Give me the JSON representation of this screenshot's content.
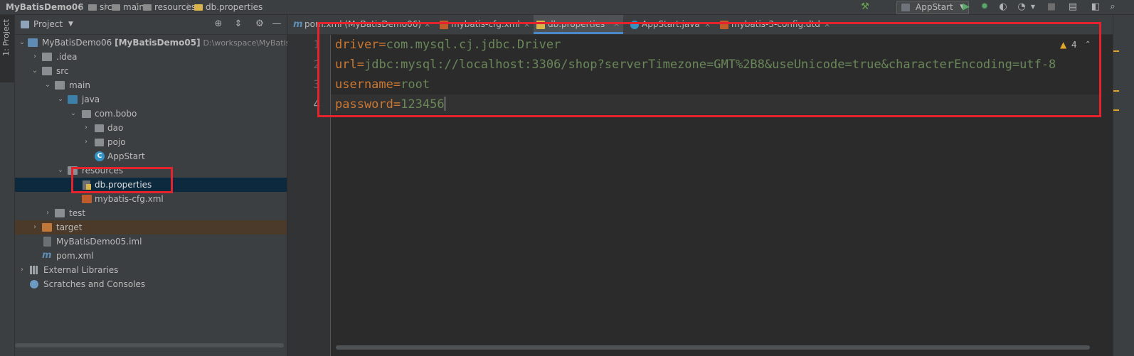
{
  "navbar": {
    "crumbs": [
      "MyBatisDemo06",
      "src",
      "main",
      "resources",
      "db.properties"
    ],
    "run_config": "AppStart",
    "icons": [
      "hammer-build-icon",
      "run-icon",
      "debug-icon",
      "coverage-icon",
      "profile-icon",
      "stop-icon",
      "project-structure-icon",
      "search-everywhere-icon"
    ]
  },
  "left_strip": {
    "project_tab": "1: Project"
  },
  "project_panel": {
    "title": "Project",
    "tree": [
      {
        "label": "MyBatisDemo06",
        "bold_suffix": "[MyBatisDemo05]",
        "hint": "D:\\workspace\\MyBatis",
        "icon": "module-folder-icon",
        "depth": 0,
        "expanded": true
      },
      {
        "label": ".idea",
        "icon": "folder-icon",
        "depth": 1,
        "expanded": false
      },
      {
        "label": "src",
        "icon": "folder-icon",
        "depth": 1,
        "expanded": true
      },
      {
        "label": "main",
        "icon": "folder-icon",
        "depth": 2,
        "expanded": true
      },
      {
        "label": "java",
        "icon": "source-folder-icon",
        "depth": 3,
        "expanded": true
      },
      {
        "label": "com.bobo",
        "icon": "package-icon",
        "depth": 4,
        "expanded": true
      },
      {
        "label": "dao",
        "icon": "package-icon",
        "depth": 5,
        "expanded": false
      },
      {
        "label": "pojo",
        "icon": "package-icon",
        "depth": 5,
        "expanded": false
      },
      {
        "label": "AppStart",
        "icon": "java-class-icon",
        "depth": 5
      },
      {
        "label": "resources",
        "icon": "resources-folder-icon",
        "depth": 3,
        "expanded": true
      },
      {
        "label": "db.properties",
        "icon": "properties-file-icon",
        "depth": 4,
        "selected": true
      },
      {
        "label": "mybatis-cfg.xml",
        "icon": "xml-file-icon",
        "depth": 4
      },
      {
        "label": "test",
        "icon": "folder-icon",
        "depth": 2,
        "expanded": false
      },
      {
        "label": "target",
        "icon": "excluded-folder-icon",
        "depth": 1,
        "expanded": false,
        "excluded": true
      },
      {
        "label": "MyBatisDemo05.iml",
        "icon": "iml-file-icon",
        "depth": 1
      },
      {
        "label": "pom.xml",
        "icon": "maven-pom-icon",
        "depth": 1
      },
      {
        "label": "External Libraries",
        "icon": "external-libraries-icon",
        "depth": 0,
        "expanded": false
      },
      {
        "label": "Scratches and Consoles",
        "icon": "scratches-icon",
        "depth": 0
      }
    ]
  },
  "editor": {
    "tabs": [
      {
        "label": "pom.xml (MyBatisDemo06)",
        "icon": "maven-pom-icon",
        "active": false
      },
      {
        "label": "mybatis-cfg.xml",
        "icon": "xml-file-icon",
        "active": false
      },
      {
        "label": "db.properties",
        "icon": "properties-file-icon",
        "active": true
      },
      {
        "label": "AppStart.java",
        "icon": "java-class-icon",
        "active": false
      },
      {
        "label": "mybatis-3-config.dtd",
        "icon": "dtd-file-icon",
        "active": false
      }
    ],
    "close_glyph": "×",
    "line_numbers": [
      "1",
      "2",
      "3",
      "4"
    ],
    "lines": [
      {
        "key": "driver",
        "eq": "=",
        "value": "com.mysql.cj.jdbc.Driver"
      },
      {
        "key": "url",
        "eq": "=",
        "value": "jdbc:mysql://localhost:3306/shop?serverTimezone=GMT%2B8&useUnicode=true&characterEncoding=utf-8"
      },
      {
        "key": "username",
        "eq": "=",
        "value": "root"
      },
      {
        "key": "password",
        "eq": "=",
        "value": "123456"
      }
    ],
    "warnings_count": "4"
  },
  "colors": {
    "highlight_box": "#e5232d",
    "key": "#cc7832",
    "value": "#6a8759",
    "selection": "#0d293e",
    "active_tab_underline": "#4a88c7"
  }
}
